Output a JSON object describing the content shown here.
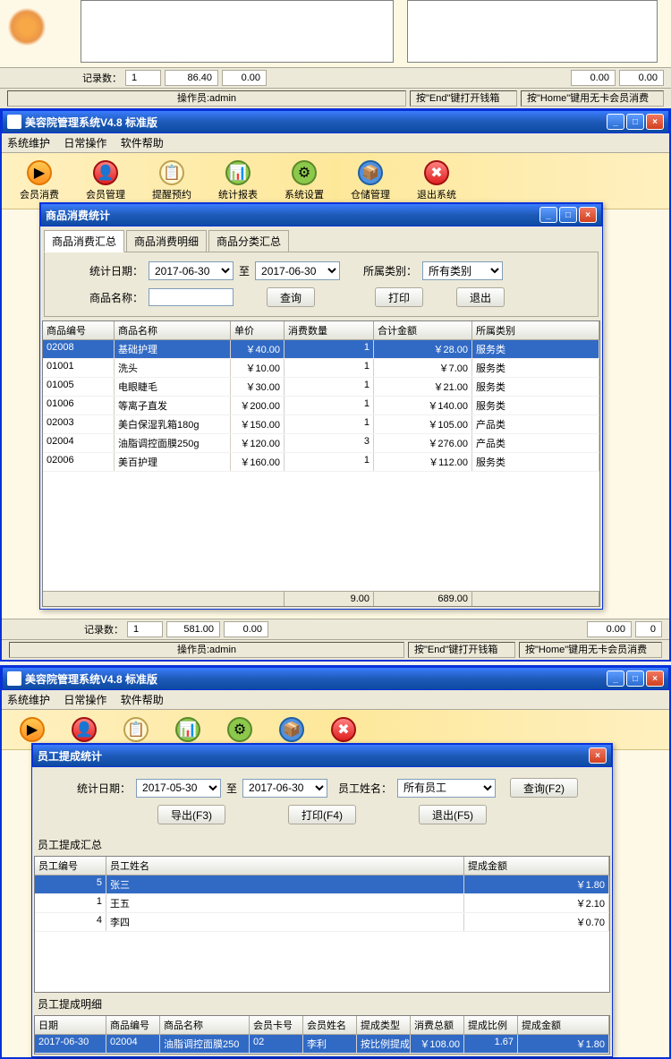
{
  "app": {
    "title": "美容院管理系统V4.8 标准版",
    "menu": {
      "maintain": "系统维护",
      "daily": "日常操作",
      "help": "软件帮助"
    }
  },
  "toolbar": {
    "consume": "会员消费",
    "member": "会员管理",
    "remind": "提醒预约",
    "stats": "统计报表",
    "settings": "系统设置",
    "store": "仓储管理",
    "exit": "退出系统"
  },
  "status_top": {
    "records_label": "记录数：",
    "records_val": "1",
    "v1": "86.40",
    "v2": "0.00",
    "v3": "0.00",
    "v4": "0.00"
  },
  "status_bar": {
    "operator_label": "操作员:",
    "operator": "admin",
    "hint1": "按\"End\"键打开钱箱",
    "hint2": "按\"Home\"键用无卡会员消费"
  },
  "dialog1": {
    "title": "商品消费统计",
    "tabs": {
      "sum": "商品消费汇总",
      "detail": "商品消费明细",
      "cat": "商品分类汇总"
    },
    "form": {
      "date_label": "统计日期：",
      "date_from": "2017-06-30",
      "to": "至",
      "date_to": "2017-06-30",
      "cat_label": "所属类别：",
      "cat_all": "所有类别",
      "name_label": "商品名称：",
      "name_val": "",
      "query": "查询",
      "print": "打印",
      "exit": "退出"
    },
    "columns": {
      "id": "商品编号",
      "name": "商品名称",
      "price": "单价",
      "qty": "消费数量",
      "total": "合计金额",
      "cat": "所属类别"
    },
    "rows": [
      {
        "id": "02008",
        "name": "基础护理",
        "price": "￥40.00",
        "qty": "1",
        "total": "￥28.00",
        "cat": "服务类"
      },
      {
        "id": "01001",
        "name": "洗头",
        "price": "￥10.00",
        "qty": "1",
        "total": "￥7.00",
        "cat": "服务类"
      },
      {
        "id": "01005",
        "name": "电眼睫毛",
        "price": "￥30.00",
        "qty": "1",
        "total": "￥21.00",
        "cat": "服务类"
      },
      {
        "id": "01006",
        "name": "等离子直发",
        "price": "￥200.00",
        "qty": "1",
        "total": "￥140.00",
        "cat": "服务类"
      },
      {
        "id": "02003",
        "name": "美白保湿乳箱180g",
        "price": "￥150.00",
        "qty": "1",
        "total": "￥105.00",
        "cat": "产品类"
      },
      {
        "id": "02004",
        "name": "油脂调控面膜250g",
        "price": "￥120.00",
        "qty": "3",
        "total": "￥276.00",
        "cat": "产品类"
      },
      {
        "id": "02006",
        "name": "美百护理",
        "price": "￥160.00",
        "qty": "1",
        "total": "￥112.00",
        "cat": "服务类"
      }
    ],
    "footer": {
      "qty": "9.00",
      "total": "689.00"
    }
  },
  "status_mid": {
    "records_label": "记录数：",
    "records_val": "1",
    "v1": "581.00",
    "v2": "0.00",
    "v3": "0.00",
    "v4": "0"
  },
  "dialog2": {
    "title": "员工提成统计",
    "form": {
      "date_label": "统计日期：",
      "date_from": "2017-05-30",
      "to": "至",
      "date_to": "2017-06-30",
      "emp_label": "员工姓名：",
      "emp_all": "所有员工",
      "query": "查询(F2)",
      "export": "导出(F3)",
      "print": "打印(F4)",
      "exit": "退出(F5)"
    },
    "section1": "员工提成汇总",
    "columns1": {
      "id": "员工编号",
      "name": "员工姓名",
      "amt": "提成金额"
    },
    "rows1": [
      {
        "id": "5",
        "name": "张三",
        "amt": "￥1.80"
      },
      {
        "id": "1",
        "name": "王五",
        "amt": "￥2.10"
      },
      {
        "id": "4",
        "name": "李四",
        "amt": "￥0.70"
      }
    ],
    "section2": "员工提成明细",
    "columns2": {
      "date": "日期",
      "pid": "商品编号",
      "pname": "商品名称",
      "card": "会员卡号",
      "mname": "会员姓名",
      "type": "提成类型",
      "tot": "消费总额",
      "ratio": "提成比例",
      "amt": "提成金额"
    },
    "rows2": [
      {
        "date": "2017-06-30",
        "pid": "02004",
        "pname": "油脂调控面膜250",
        "card": "02",
        "mname": "李利",
        "type": "按比例提成",
        "tot": "￥108.00",
        "ratio": "1.67",
        "amt": "￥1.80"
      }
    ]
  }
}
